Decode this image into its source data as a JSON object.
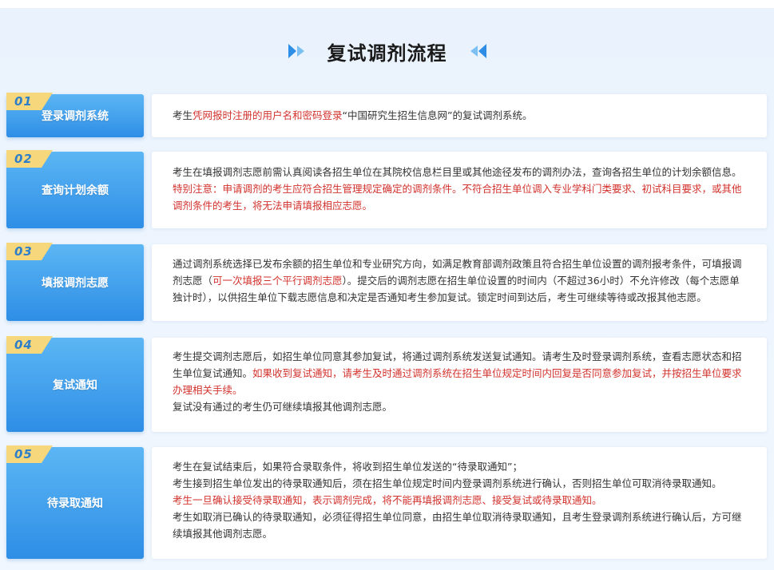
{
  "page": {
    "title": "复试调剂流程",
    "colors": {
      "accent_blue": "#2e8ee6",
      "badge_yellow": "#f7d77b",
      "highlight_red": "#d2322d"
    }
  },
  "steps": [
    {
      "number": "01",
      "label": "登录调剂系统",
      "lines": [
        [
          {
            "text": "考生",
            "red": false
          },
          {
            "text": "凭网报时注册的用户名和密码登录",
            "red": true
          },
          {
            "text": "“中国研究生招生信息网”的复试调剂系统。",
            "red": false
          }
        ]
      ]
    },
    {
      "number": "02",
      "label": "查询计划余额",
      "lines": [
        [
          {
            "text": "考生在填报调剂志愿前需认真阅读各招生单位在其院校信息栏目里或其他途径发布的调剂办法，查询各招生单位的计划余额信息。",
            "red": false
          }
        ],
        [
          {
            "text": "特别注意：申请调剂的考生应符合招生管理规定确定的调剂条件。不符合招生单位调入专业学科门类要求、初试科目要求，或其他调剂条件的考生，将无法申请填报相应志愿。",
            "red": true
          }
        ]
      ]
    },
    {
      "number": "03",
      "label": "填报调剂志愿",
      "lines": [
        [
          {
            "text": "通过调剂系统选择已发布余额的招生单位和专业研究方向，如满足教育部调剂政策且符合招生单位设置的调剂报考条件，可填报调剂志愿（",
            "red": false
          },
          {
            "text": "可一次填报三个平行调剂志愿",
            "red": true
          },
          {
            "text": "）。提交后的调剂志愿在招生单位设置的时间内（不超过36小时）不允许修改（每个志愿单独计时），以供招生单位下载志愿信息和决定是否通知考生参加复试。锁定时间到达后，考生可继续等待或改报其他志愿。",
            "red": false
          }
        ]
      ]
    },
    {
      "number": "04",
      "label": "复试通知",
      "lines": [
        [
          {
            "text": "考生提交调剂志愿后，如招生单位同意其参加复试，将通过调剂系统发送复试通知。请考生及时登录调剂系统，查看志愿状态和招生单位复试通知。",
            "red": false
          },
          {
            "text": "如果收到复试通知，请考生及时通过调剂系统在招生单位规定时间内回复是否同意参加复试，并按招生单位要求办理相关手续。",
            "red": true
          }
        ],
        [
          {
            "text": "复试没有通过的考生仍可继续填报其他调剂志愿。",
            "red": false
          }
        ]
      ]
    },
    {
      "number": "05",
      "label": "待录取通知",
      "lines": [
        [
          {
            "text": "考生在复试结束后，如果符合录取条件，将收到招生单位发送的“待录取通知”；",
            "red": false
          }
        ],
        [
          {
            "text": "考生接到招生单位发出的待录取通知后，须在招生单位规定时间内登录调剂系统进行确认，否则招生单位可取消待录取通知。",
            "red": false
          }
        ],
        [
          {
            "text": "考生一旦确认接受待录取通知，表示调剂完成，将不能再填报调剂志愿、接受复试或待录取通知。",
            "red": true
          }
        ],
        [
          {
            "text": "考生如取消已确认的待录取通知，必须征得招生单位同意，由招生单位取消待录取通知，且考生登录调剂系统进行确认后，方可继续填报其他调剂志愿。",
            "red": false
          }
        ]
      ]
    }
  ]
}
